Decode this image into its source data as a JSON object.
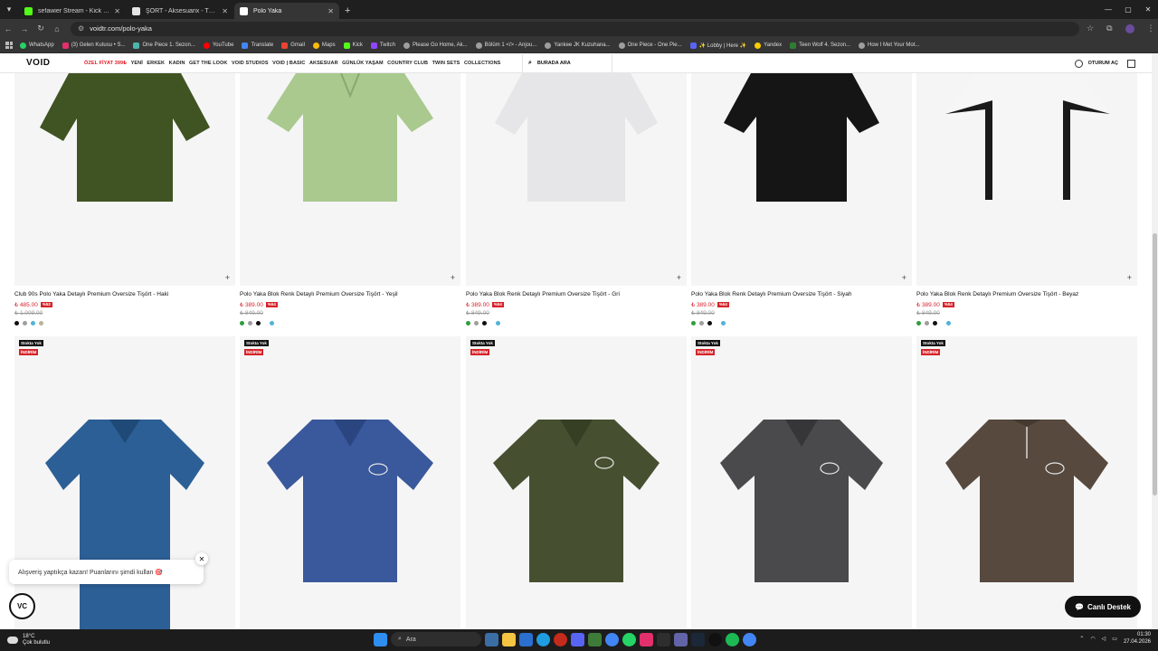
{
  "browser": {
    "tabs": [
      {
        "label": "sefawier Stream - Kick Dashbo...",
        "icon": "kick-icon",
        "color": "#53fc18"
      },
      {
        "label": "ŞORT - Aksesuarix - Türkiye'nin...",
        "icon": "aksesuarix-icon",
        "color": "#e5e5e5"
      },
      {
        "label": "Polo Yaka",
        "icon": "void-icon",
        "color": "#ffffff"
      }
    ],
    "url": "voidtr.com/polo-yaka",
    "bookmarks": [
      {
        "label": "WhatsApp",
        "color": "#25d366"
      },
      {
        "label": "(3) Gelen Kutusu • S...",
        "color": "#e1306c"
      },
      {
        "label": "One Piece 1. Sezon...",
        "color": "#4db6ac"
      },
      {
        "label": "YouTube",
        "color": "#ff0000"
      },
      {
        "label": "Translate",
        "color": "#4285f4"
      },
      {
        "label": "Gmail",
        "color": "#ea4335"
      },
      {
        "label": "Maps",
        "color": "#fbbc05"
      },
      {
        "label": "Kick",
        "color": "#53fc18"
      },
      {
        "label": "Twitch",
        "color": "#9146ff"
      },
      {
        "label": "Please Go Home, Ak...",
        "color": "#9e9e9e"
      },
      {
        "label": "Bölüm 1 </> - Anjou...",
        "color": "#9e9e9e"
      },
      {
        "label": "Yankee JK Kuzuhana...",
        "color": "#9e9e9e"
      },
      {
        "label": "One Piece - One Pie...",
        "color": "#9e9e9e"
      },
      {
        "label": "✨ Lobby | Here ✨",
        "color": "#5865f2"
      },
      {
        "label": "Yandex",
        "color": "#ffcc00"
      },
      {
        "label": "Teen Wolf 4. Sezon...",
        "color": "#2e7d32"
      },
      {
        "label": "How I Met Your Mot...",
        "color": "#9e9e9e"
      }
    ]
  },
  "site": {
    "logo": "VOID",
    "nav": [
      "ÖZEL FİYAT 399₺",
      "YENİ",
      "ERKEK",
      "KADIN",
      "GET THE LOOK",
      "VOID STUDIOS",
      "VOID | BASIC",
      "AKSESUAR",
      "GÜNLÜK YAŞAM",
      "COUNTRY CLUB",
      "TWIN SETS",
      "COLLECTIONS"
    ],
    "search_label": "BURADA ARA",
    "login_label": "OTURUM AÇ"
  },
  "products_row1": [
    {
      "name": "Club 90s Polo Yaka Detaylı Premium Oversize Tişört - Haki",
      "price": "₺ 485.00",
      "discount": "%52",
      "old_price": "₺ 1.009.00",
      "color": "#3f5422",
      "swatches": [
        "#111111",
        "#9e9e9e",
        "#4fb3d9",
        "#b9b39a"
      ]
    },
    {
      "name": "Polo Yaka Blok Renk Detaylı Premium Oversize Tişört - Yeşil",
      "price": "₺ 389.00",
      "discount": "%54",
      "old_price": "₺ 849.00",
      "color": "#a9c98e",
      "swatches": [
        "#2e9e3e",
        "#9e9e9e",
        "#111111",
        "#4fb3d9"
      ]
    },
    {
      "name": "Polo Yaka Blok Renk Detaylı Premium Oversize Tişört - Gri",
      "price": "₺ 389.00",
      "discount": "%54",
      "old_price": "₺ 849.00",
      "color": "#e6e6e8",
      "swatches": [
        "#2e9e3e",
        "#9e9e9e",
        "#111111",
        "#4fb3d9"
      ]
    },
    {
      "name": "Polo Yaka Blok Renk Detaylı Premium Oversize Tişört - Siyah",
      "price": "₺ 389.00",
      "discount": "%54",
      "old_price": "₺ 849.00",
      "color": "#151515",
      "swatches": [
        "#2e9e3e",
        "#9e9e9e",
        "#111111",
        "#4fb3d9"
      ]
    },
    {
      "name": "Polo Yaka Blok Renk Detaylı Premium Oversize Tişört - Beyaz",
      "price": "₺ 389.00",
      "discount": "%54",
      "old_price": "₺ 849.00",
      "color": "#f6f6f6",
      "swatches": [
        "#2e9e3e",
        "#9e9e9e",
        "#111111",
        "#4fb3d9"
      ]
    }
  ],
  "products_row2": [
    {
      "stock": "Stokta Yok",
      "sale": "İNDİRİM",
      "color": "#2c5f95"
    },
    {
      "stock": "Stokta Yok",
      "sale": "İNDİRİM",
      "color": "#3a589c"
    },
    {
      "stock": "Stokta Yok",
      "sale": "İNDİRİM",
      "color": "#465030"
    },
    {
      "stock": "Stokta Yok",
      "sale": "İNDİRİM",
      "color": "#4a4a4c"
    },
    {
      "stock": "Stokta Yok",
      "sale": "İNDİRİM",
      "color": "#57493e"
    }
  ],
  "toast": {
    "text": "Alışveriş yaptıkça kazan! Puanlarını şimdi kullan 🎯",
    "close": "✕"
  },
  "support": {
    "label": "Canlı Destek"
  },
  "vc_logo": "VC",
  "taskbar": {
    "temp": "18°C",
    "weather": "Çok bulutlu",
    "search": "Ara",
    "time": "01:30",
    "date": "27.04.2026"
  }
}
